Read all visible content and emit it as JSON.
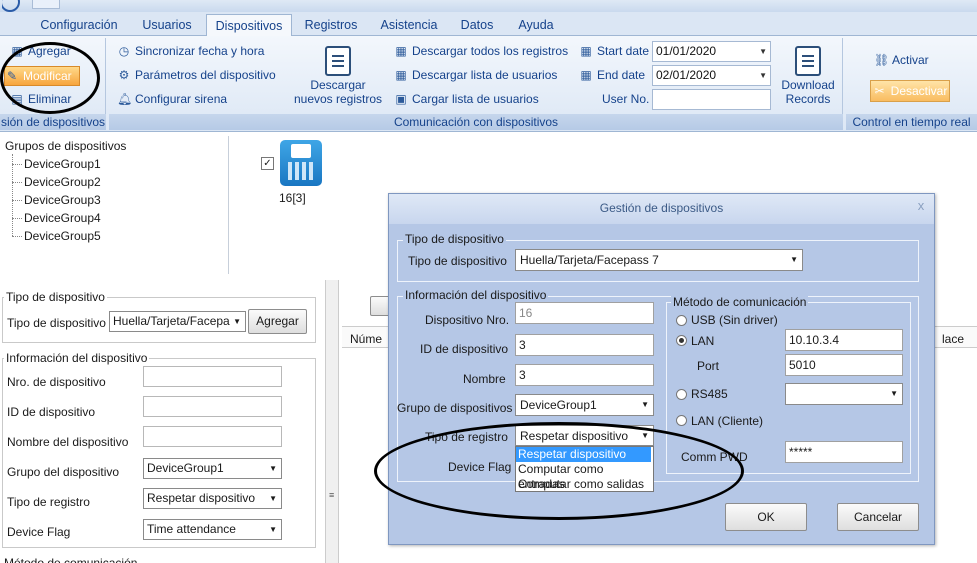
{
  "menu": {
    "tabs": [
      "Configuración",
      "Usuarios",
      "Dispositivos",
      "Registros",
      "Asistencia",
      "Datos",
      "Ayuda"
    ],
    "active": "Dispositivos"
  },
  "ribbon": {
    "group1": {
      "add": "Agregar",
      "modify": "Modificar",
      "delete": "Eliminar",
      "caption": "sión de dispositivos"
    },
    "group2": {
      "sync_time": "Sincronizar fecha y hora",
      "device_params": "Parámetros del dispositivo",
      "config_siren": "Configurar sirena",
      "download_new": "Descargar nuevos registros",
      "download_all": "Descargar todos los registros",
      "download_users": "Descargar lista de usuarios",
      "upload_users": "Cargar lista de usuarios",
      "start_date_label": "Start date",
      "start_date": "01/01/2020",
      "end_date_label": "End date",
      "end_date": "02/01/2020",
      "user_no_label": "User No.",
      "download_records": "Download Records",
      "caption": "Comunicación con dispositivos"
    },
    "group3": {
      "activate": "Activar",
      "deactivate": "Desactivar",
      "caption": "Control en tiempo real"
    }
  },
  "tree": {
    "root": "Grupos de dispositivos",
    "items": [
      "DeviceGroup1",
      "DeviceGroup2",
      "DeviceGroup3",
      "DeviceGroup4",
      "DeviceGroup5"
    ]
  },
  "device": {
    "label": "16[3]"
  },
  "left_form": {
    "type_legend": "Tipo de dispositivo",
    "type_label": "Tipo de dispositivo",
    "type_value": "Huella/Tarjeta/Facepa",
    "add_button": "Agregar",
    "info_legend": "Información del dispositivo",
    "nro_label": "Nro. de dispositivo",
    "id_label": "ID de dispositivo",
    "name_label": "Nombre del dispositivo",
    "group_label": "Grupo del dispositivo",
    "group_value": "DeviceGroup1",
    "record_label": "Tipo de registro",
    "record_value": "Respetar dispositivo",
    "flag_label": "Device Flag",
    "flag_value": "Time attendance",
    "comm_legend_partial": "Método de comunicación"
  },
  "list": {
    "col_num": "Núme",
    "col_right": "lace"
  },
  "dialog": {
    "title": "Gestión de dispositivos",
    "close": "x",
    "type_legend": "Tipo de dispositivo",
    "type_label": "Tipo de dispositivo",
    "type_value": "Huella/Tarjeta/Facepass 7",
    "info_legend": "Información del dispositivo",
    "nro_label": "Dispositivo Nro.",
    "nro_value": "16",
    "id_label": "ID de dispositivo",
    "id_value": "3",
    "name_label": "Nombre",
    "name_value": "3",
    "group_label": "Grupo de dispositivos",
    "group_value": "DeviceGroup1",
    "record_label": "Tipo de registro",
    "record_value": "Respetar dispositivo",
    "flag_label": "Device Flag",
    "record_options": [
      "Respetar dispositivo",
      "Computar como entradas",
      "Computar como salidas"
    ],
    "comm_legend": "Método de comunicación",
    "usb_label": "USB (Sin driver)",
    "lan_label": "LAN",
    "lan_ip": "10.10.3.4",
    "port_label": "Port",
    "port_value": "5010",
    "rs485_label": "RS485",
    "lan_client_label": "LAN (Cliente)",
    "comm_pwd_label": "Comm PWD",
    "comm_pwd_value": "*****",
    "ok": "OK",
    "cancel": "Cancelar"
  },
  "colors": {
    "ribbon_text": "#15428b",
    "highlight_orange": "#f7a53e",
    "dialog_bg": "#b5c7e6",
    "selection_blue": "#3399ff"
  }
}
